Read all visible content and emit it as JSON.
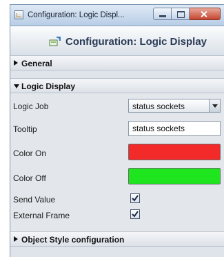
{
  "window": {
    "title": "Configuration: Logic Displ...",
    "minimize_label": "",
    "maximize_label": "",
    "close_label": ""
  },
  "header": {
    "title": "Configuration: Logic Display"
  },
  "sections": {
    "general": {
      "label": "General",
      "expanded": false
    },
    "logic_display": {
      "label": "Logic Display",
      "expanded": true,
      "fields": {
        "logic_job": {
          "label": "Logic Job",
          "value": "status sockets"
        },
        "tooltip": {
          "label": "Tooltip",
          "value": "status sockets"
        },
        "color_on": {
          "label": "Color On",
          "color": "#f22a2a"
        },
        "color_off": {
          "label": "Color Off",
          "color": "#1fe51f"
        },
        "send_value": {
          "label": "Send Value",
          "checked": true
        },
        "external_frame": {
          "label": "External Frame",
          "checked": true
        }
      }
    },
    "object_style": {
      "label": "Object Style configuration",
      "expanded": false
    }
  },
  "icons": {
    "app": "app-icon",
    "header": "configuration-icon",
    "expand": "triangle-right-icon",
    "collapse": "triangle-down-icon",
    "dropdown": "chevron-down-icon",
    "check": "checkmark-icon"
  }
}
